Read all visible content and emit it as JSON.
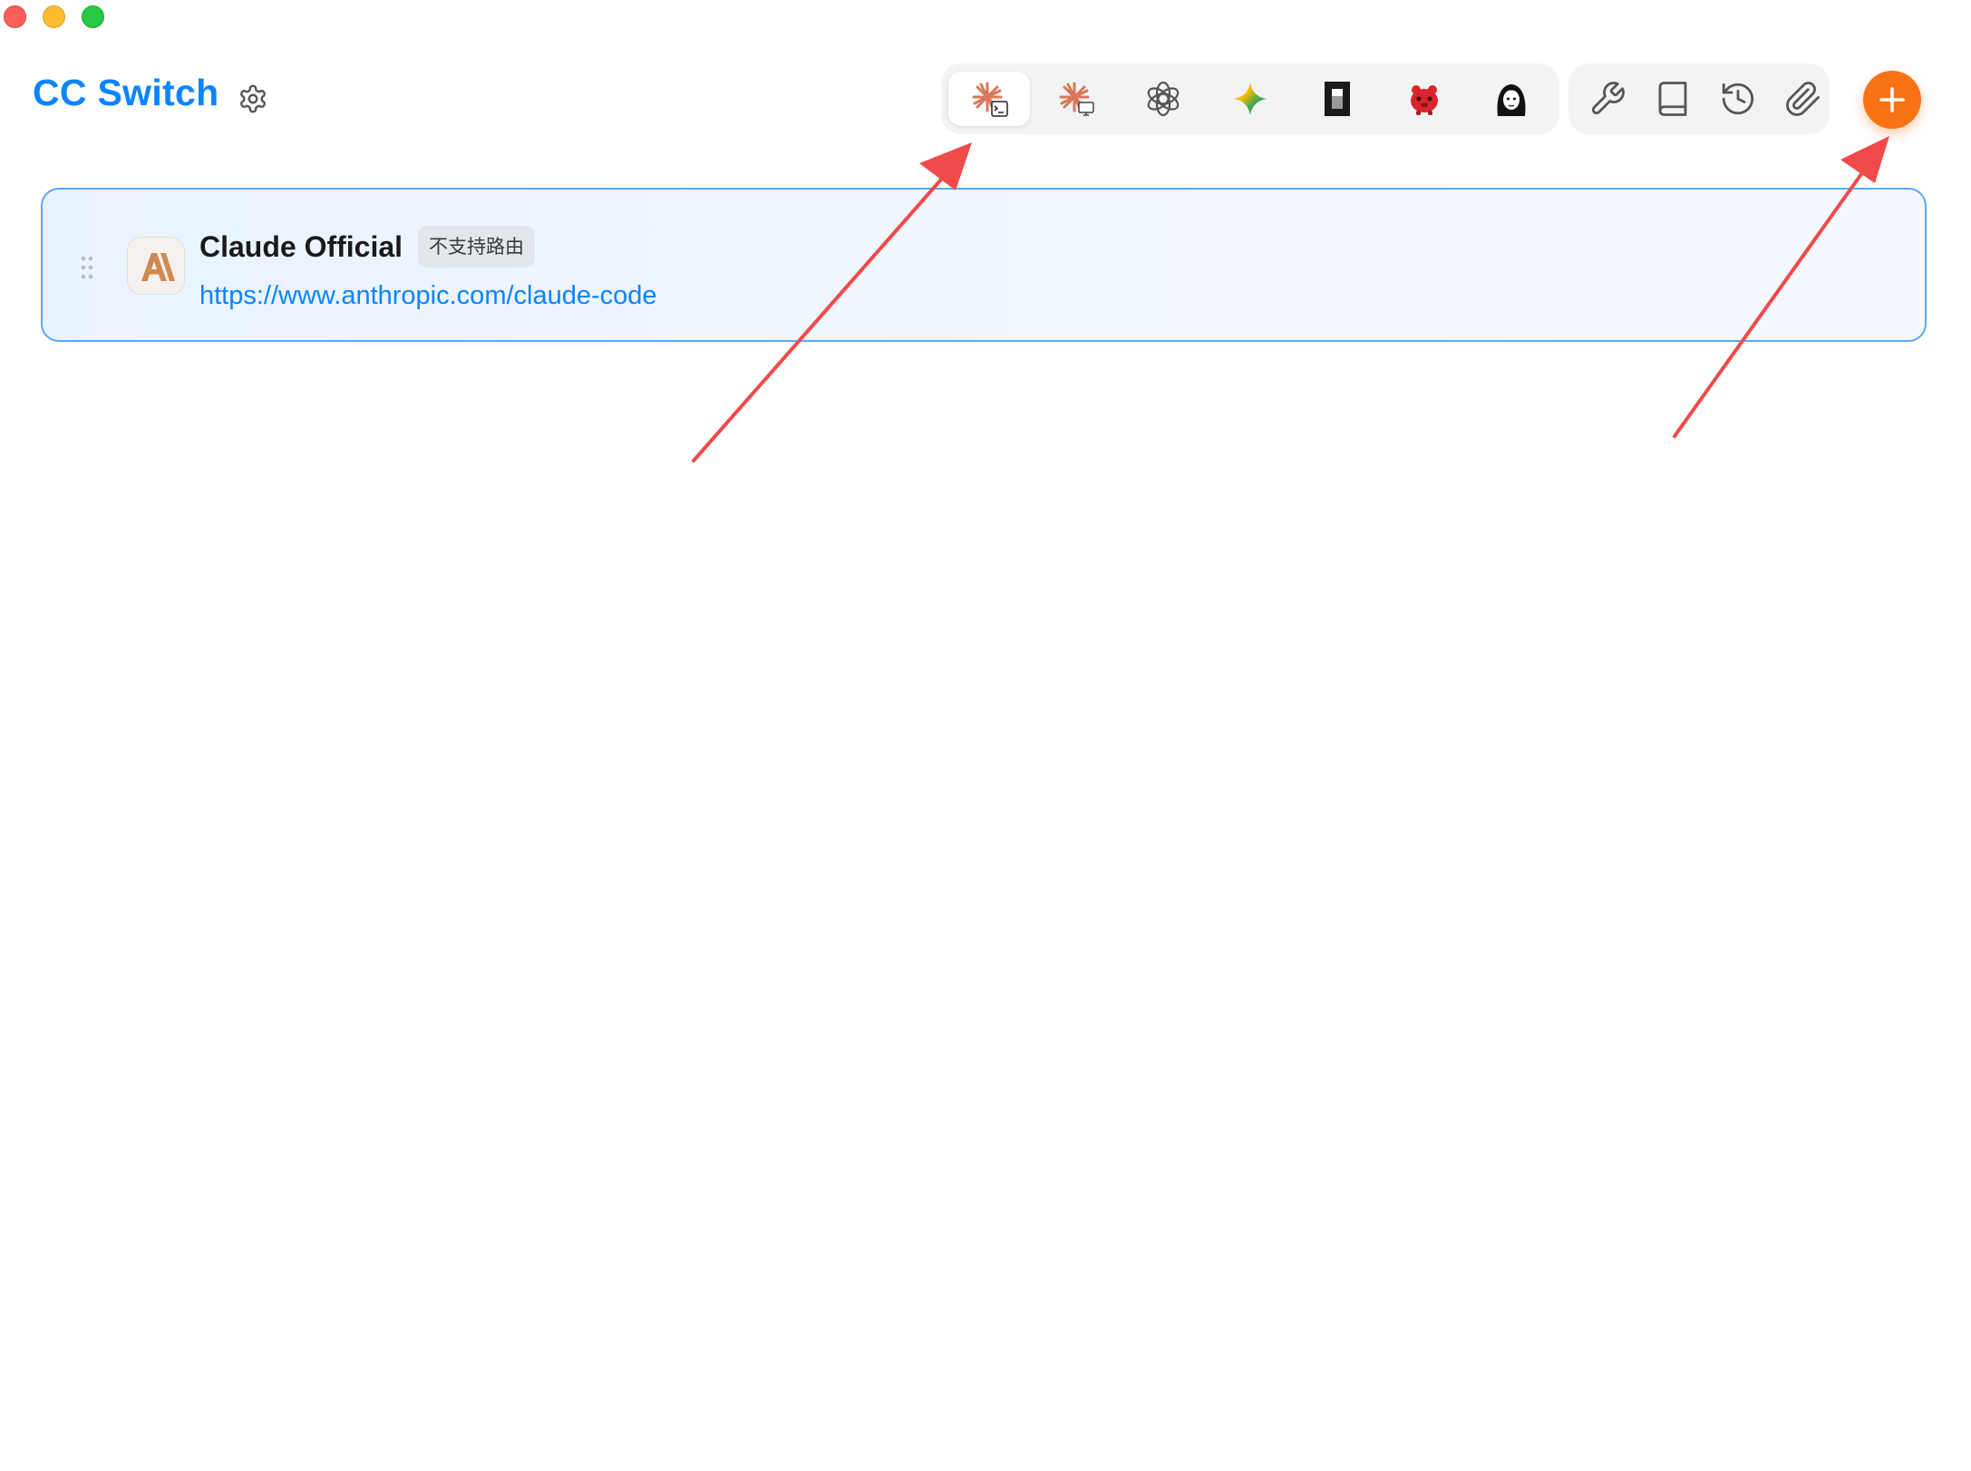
{
  "window": {
    "controls": [
      "close",
      "minimize",
      "maximize"
    ]
  },
  "header": {
    "title": "CC Switch",
    "settings_icon": "gear-icon"
  },
  "app_switcher": {
    "tabs": [
      {
        "name": "claude-code",
        "icon": "claude-terminal-icon",
        "active": true
      },
      {
        "name": "claude-desktop",
        "icon": "claude-desktop-icon",
        "active": false
      },
      {
        "name": "openai-codex",
        "icon": "openai-icon",
        "active": false
      },
      {
        "name": "gemini",
        "icon": "gemini-sparkle-icon",
        "active": false
      },
      {
        "name": "opencode",
        "icon": "opencode-icon",
        "active": false
      },
      {
        "name": "red-mascot-app",
        "icon": "red-mascot-icon",
        "active": false
      },
      {
        "name": "character-app",
        "icon": "character-avatar-icon",
        "active": false
      }
    ]
  },
  "tools": [
    {
      "icon": "wrench-icon"
    },
    {
      "icon": "book-icon"
    },
    {
      "icon": "history-icon"
    },
    {
      "icon": "paperclip-icon"
    }
  ],
  "add_button": {
    "icon": "plus-icon",
    "color": "#f97316"
  },
  "providers": [
    {
      "name": "Claude Official",
      "badge": "不支持路由",
      "url": "https://www.anthropic.com/claude-code",
      "logo": "anthropic-logo",
      "selected": true
    }
  ],
  "colors": {
    "accent": "#0a84ff",
    "add_button": "#f97316",
    "annotation_arrow": "#f04a4a",
    "claude_orange": "#d97757"
  }
}
